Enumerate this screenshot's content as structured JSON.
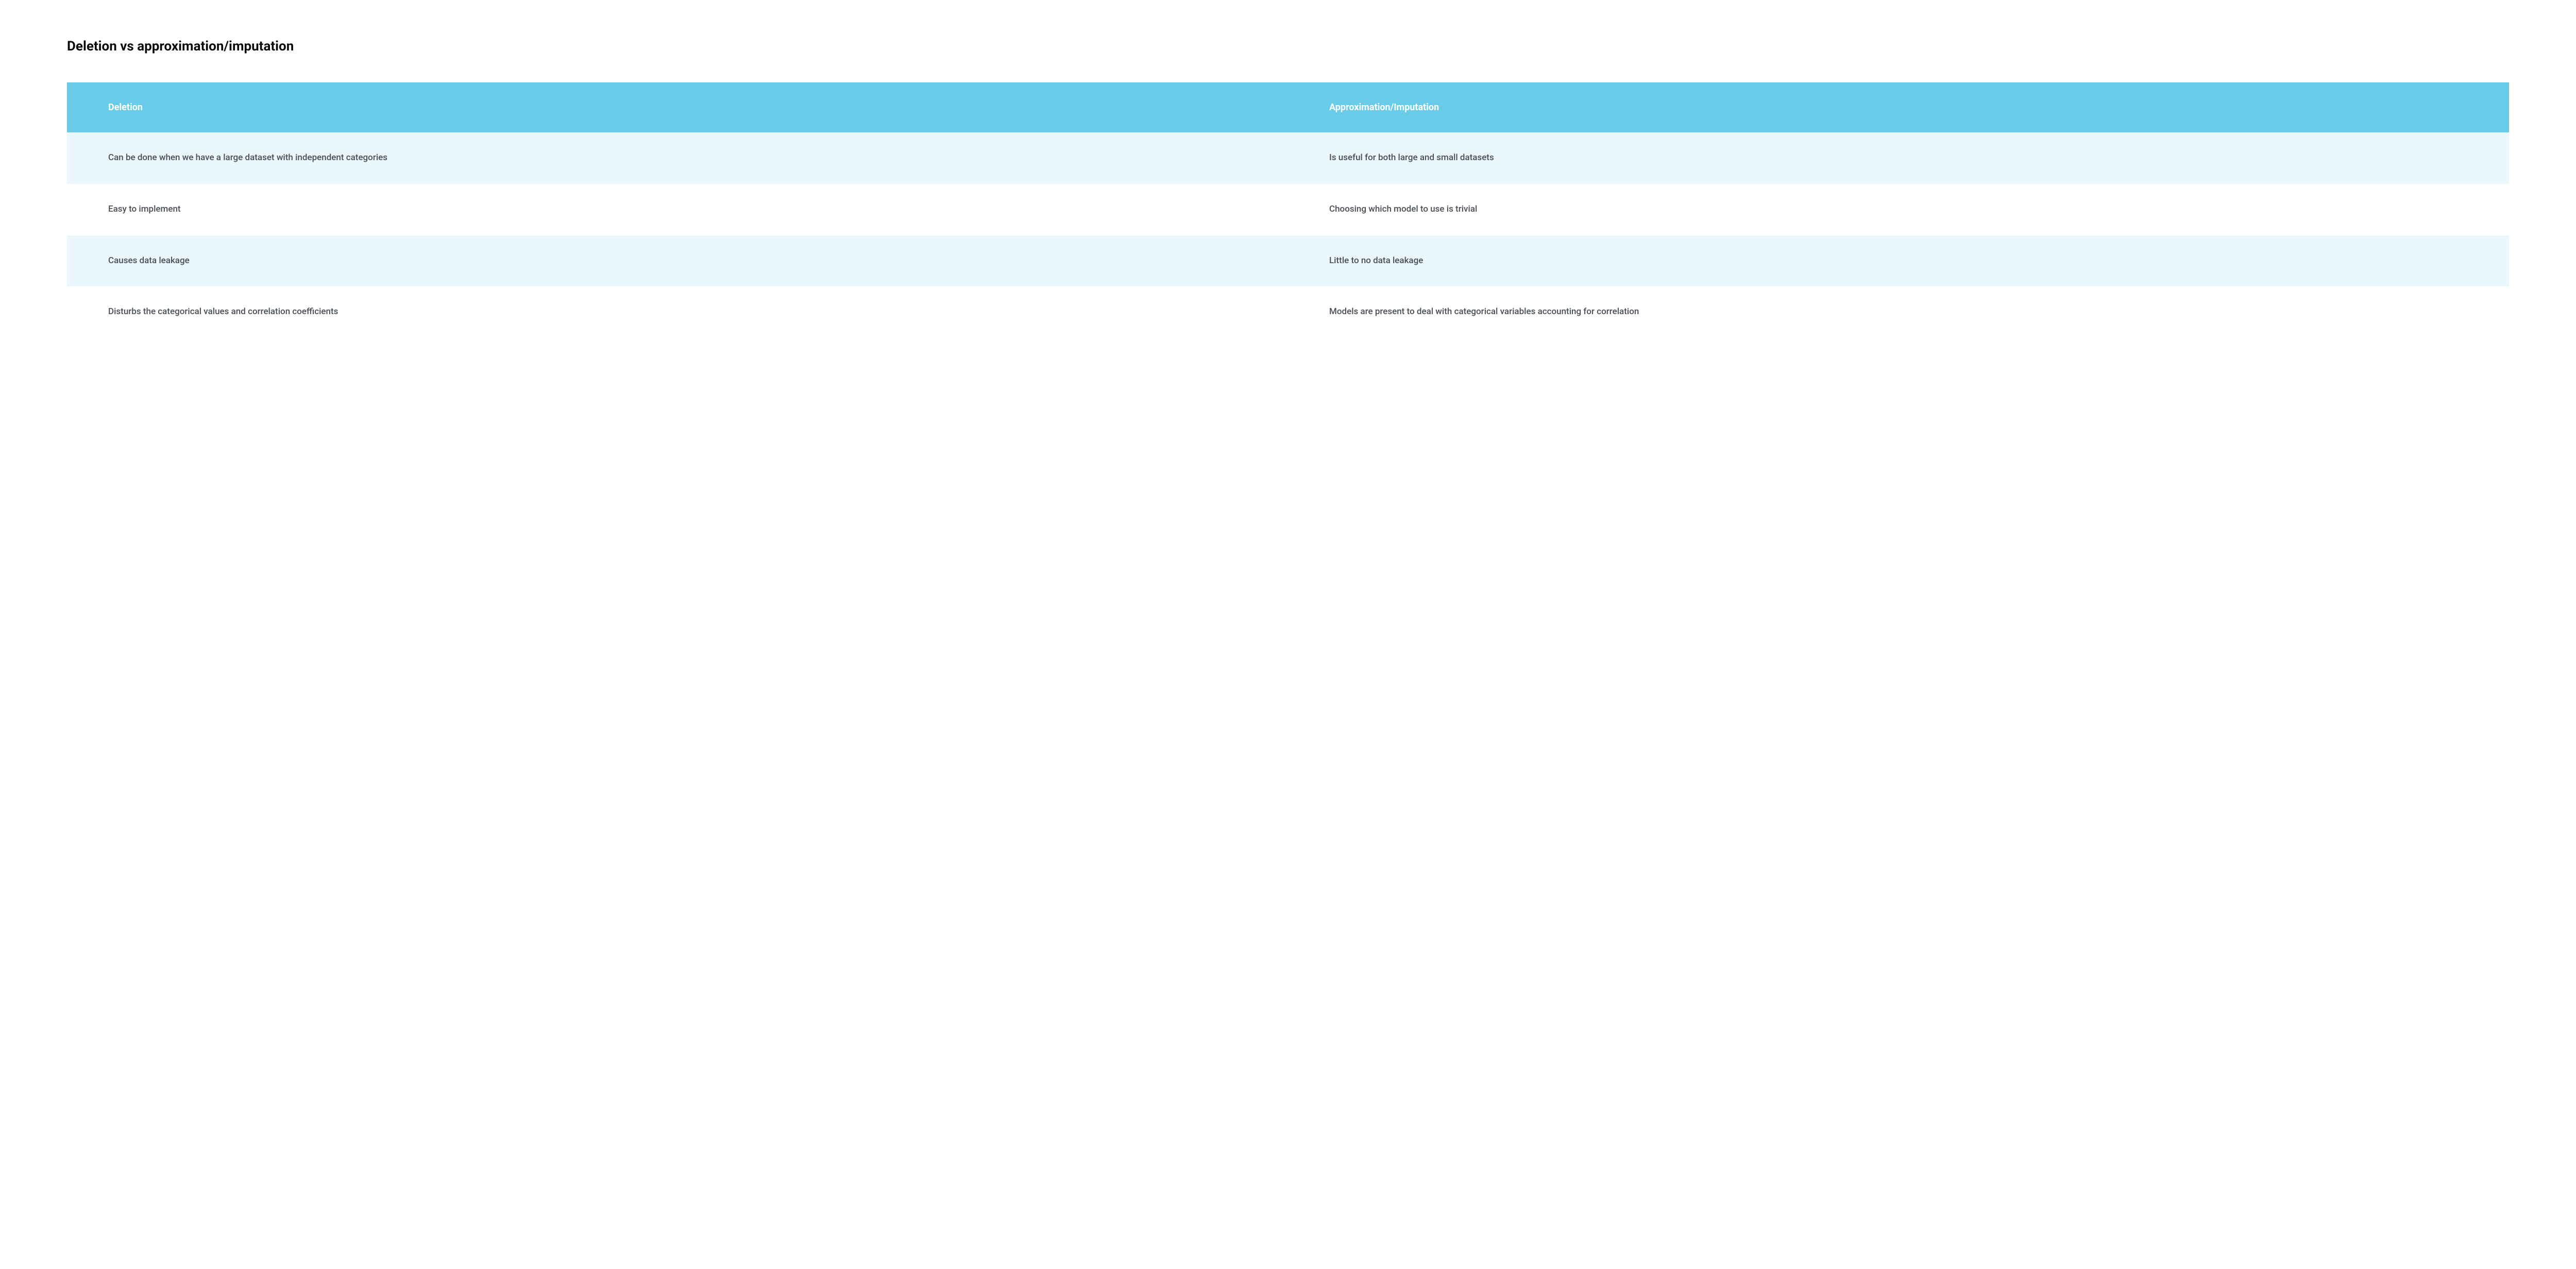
{
  "title": "Deletion vs approximation/imputation",
  "columns": [
    "Deletion",
    "Approximation/Imputation"
  ],
  "rows": [
    {
      "left": "Can be done when we have a large dataset with independent categories",
      "right": "Is useful for both large and small datasets"
    },
    {
      "left": "Easy to implement",
      "right": "Choosing which model to use is trivial"
    },
    {
      "left": "Causes data leakage",
      "right": "Little to no data leakage"
    },
    {
      "left": "Disturbs the categorical values and correlation coefficients",
      "right": "Models are present to deal with categorical variables accounting for correlation"
    }
  ]
}
